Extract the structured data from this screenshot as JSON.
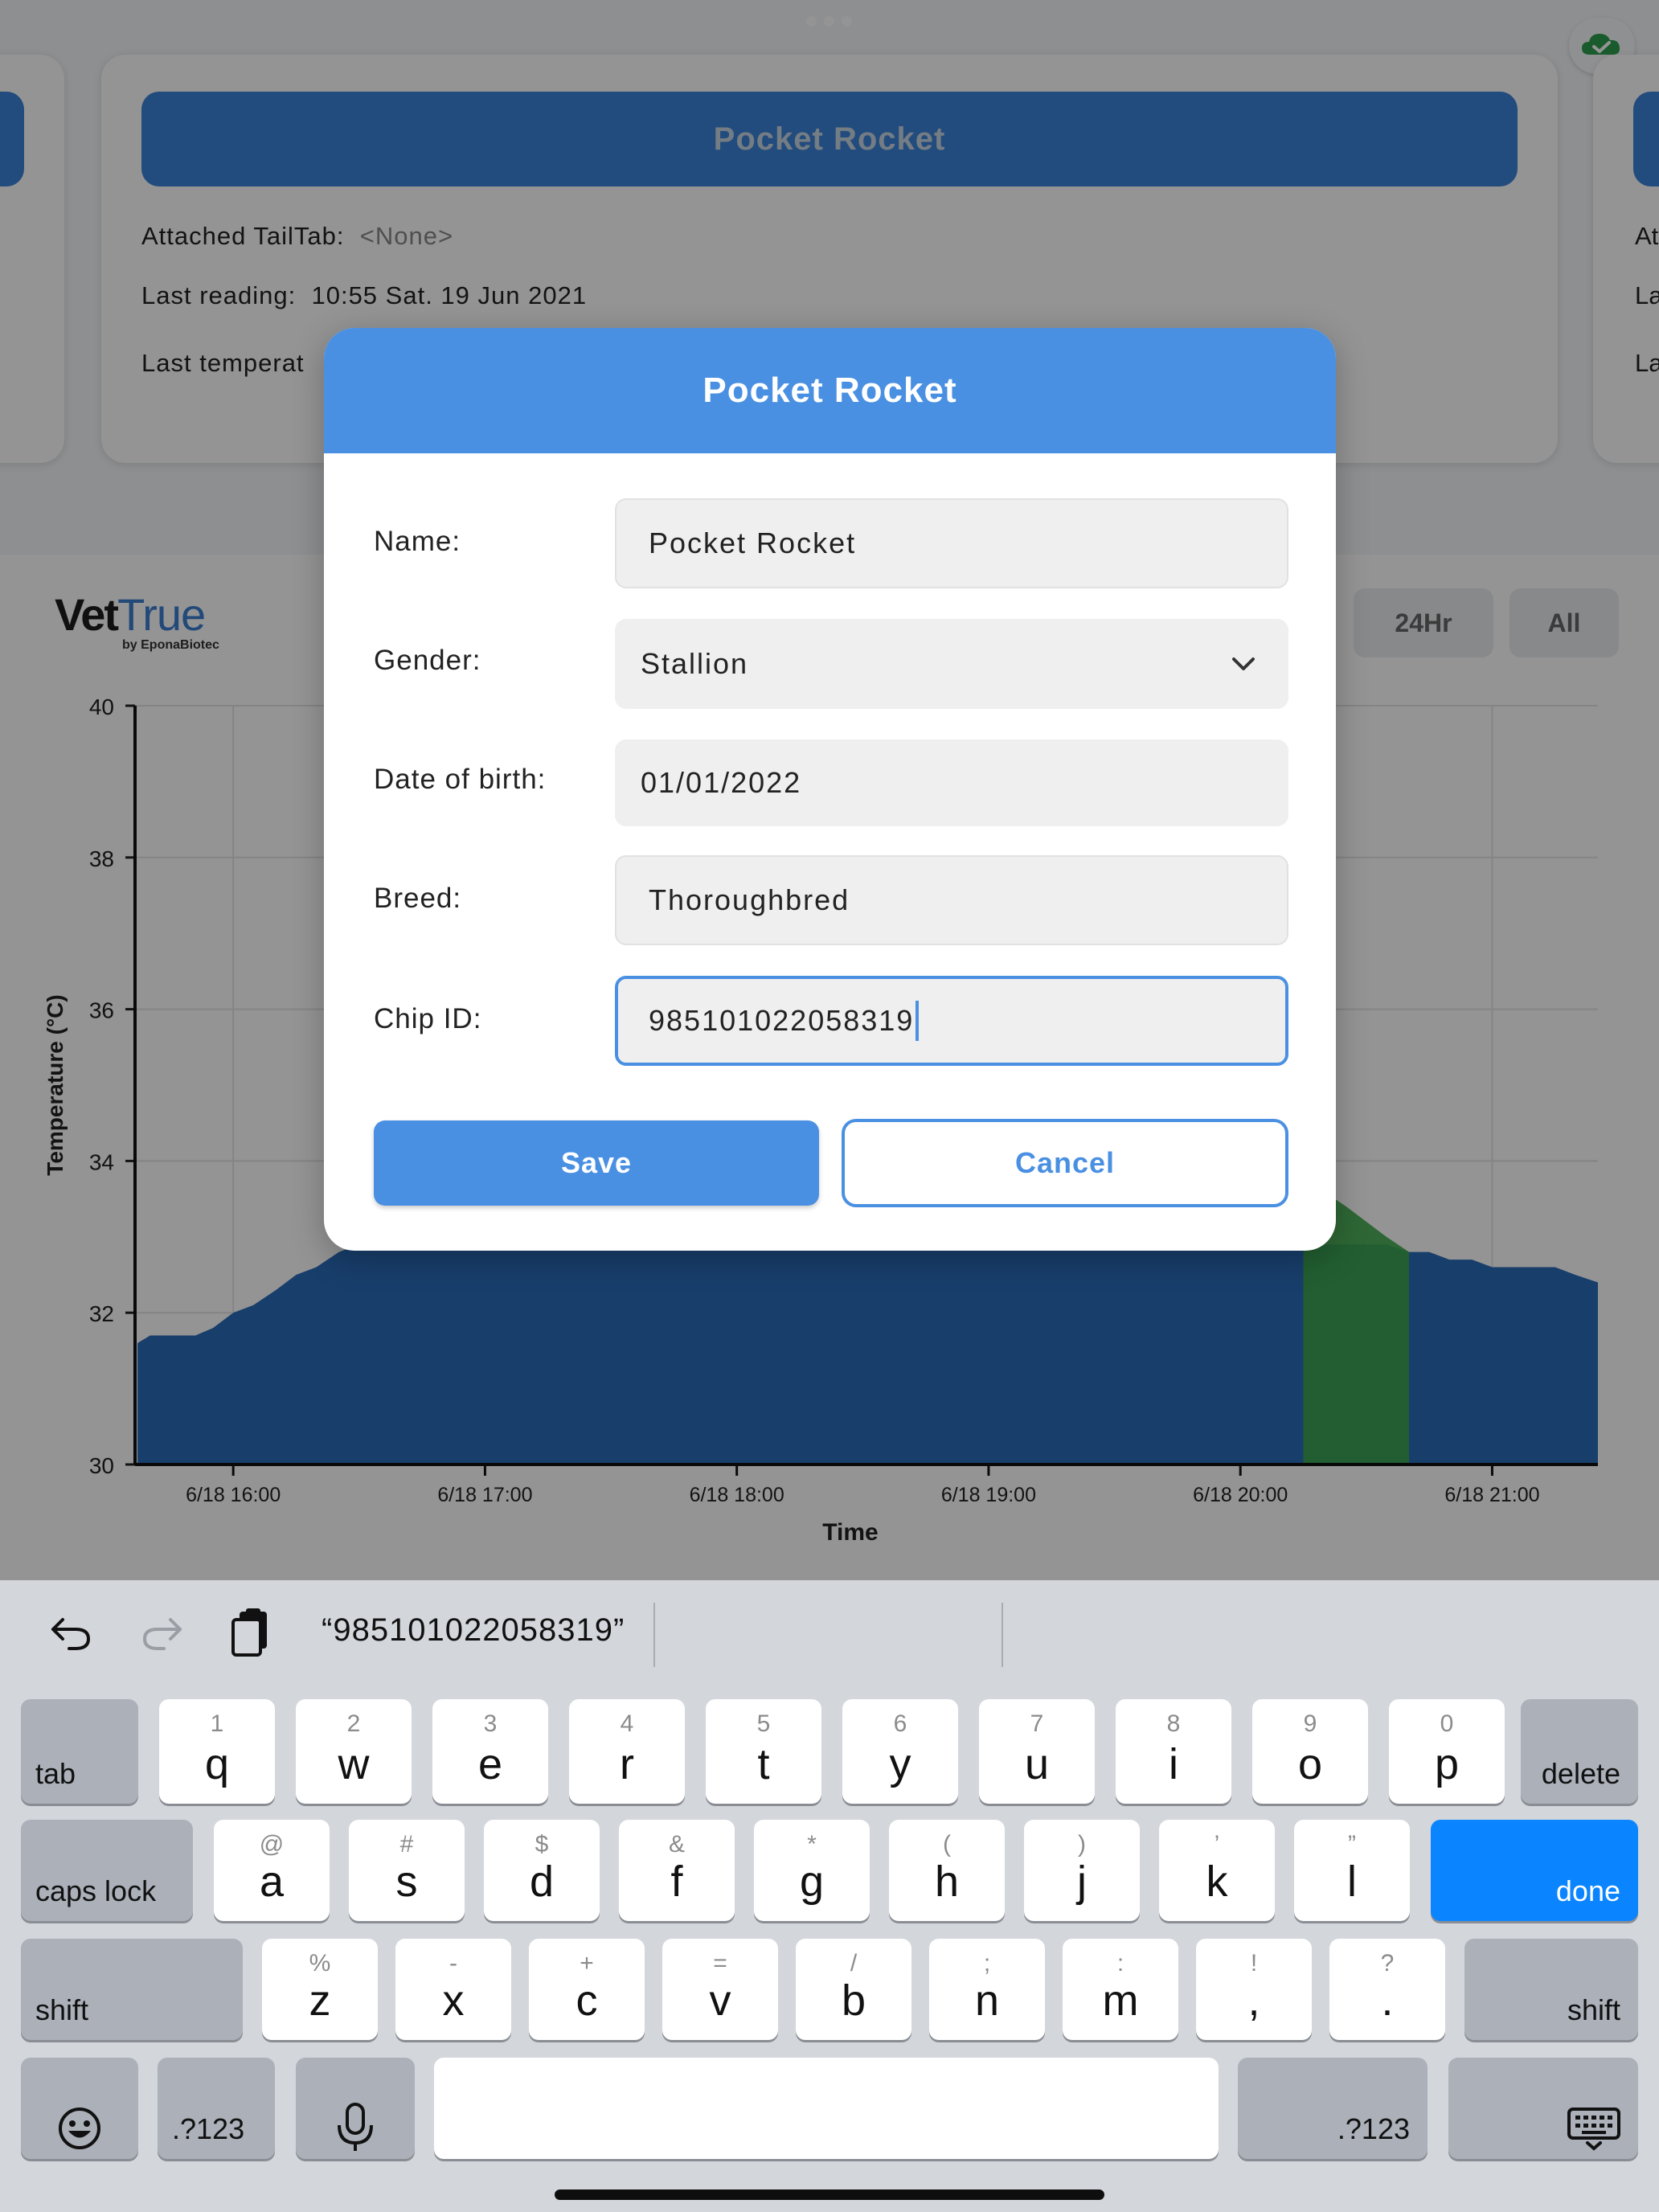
{
  "background": {
    "card_title": "Pocket Rocket",
    "attached_label": "Attached TailTab:",
    "attached_value": "<None>",
    "last_reading_label": "Last reading:",
    "last_reading_value": "10:55 Sat. 19 Jun 2021",
    "last_temp_label": "Last temperat",
    "side_card_lines": [
      "At",
      "La",
      "La"
    ],
    "logo_vet": "Vet",
    "logo_true": "True",
    "logo_by": "by EponaBiotec",
    "range_buttons": [
      "24Hr",
      "All"
    ],
    "cloud_icon_color": "#2e9e4f"
  },
  "chart_data": {
    "type": "area",
    "ylabel": "Temperature (°C)",
    "xlabel": "Time",
    "ylim": [
      30,
      40
    ],
    "yticks": [
      "30",
      "32",
      "34",
      "36",
      "38",
      "40"
    ],
    "xticks": [
      "6/18 16:00",
      "6/18 17:00",
      "6/18 18:00",
      "6/18 19:00",
      "6/18 20:00",
      "6/18 21:00"
    ],
    "grid": true,
    "series": [
      {
        "color": "#2a6bb8",
        "x_hours": [
          15.62,
          15.67,
          15.85,
          15.92,
          16.0,
          16.08,
          16.17,
          16.25,
          16.33,
          16.42,
          16.5,
          20.33,
          20.42,
          20.5,
          20.58,
          20.67,
          20.75,
          20.83,
          20.92,
          21.0,
          21.08,
          21.17,
          21.25,
          21.33,
          21.42
        ],
        "values": [
          31.6,
          31.7,
          31.7,
          31.8,
          32.0,
          32.1,
          32.3,
          32.5,
          32.6,
          32.8,
          32.9,
          32.9,
          32.9,
          32.9,
          32.9,
          32.8,
          32.8,
          32.7,
          32.7,
          32.6,
          32.6,
          32.6,
          32.6,
          32.5,
          32.4
        ]
      },
      {
        "color": "#3da84a",
        "x_hours": [
          20.25,
          20.33,
          20.42,
          20.5,
          20.58,
          20.67
        ],
        "values": [
          33.4,
          33.6,
          33.4,
          33.2,
          33.0,
          32.8
        ]
      }
    ]
  },
  "dialog": {
    "title": "Pocket Rocket",
    "fields": {
      "name_label": "Name:",
      "name_value": "Pocket Rocket",
      "gender_label": "Gender:",
      "gender_value": "Stallion",
      "dob_label": "Date of birth:",
      "dob_value": "01/01/2022",
      "breed_label": "Breed:",
      "breed_value": "Thoroughbred",
      "chip_label": "Chip ID:",
      "chip_value": "985101022058319"
    },
    "save_label": "Save",
    "cancel_label": "Cancel",
    "accent_color": "#4a90e2"
  },
  "keyboard": {
    "suggestion": "“985101022058319”",
    "row1": [
      {
        "main": "q",
        "alt": "1"
      },
      {
        "main": "w",
        "alt": "2"
      },
      {
        "main": "e",
        "alt": "3"
      },
      {
        "main": "r",
        "alt": "4"
      },
      {
        "main": "t",
        "alt": "5"
      },
      {
        "main": "y",
        "alt": "6"
      },
      {
        "main": "u",
        "alt": "7"
      },
      {
        "main": "i",
        "alt": "8"
      },
      {
        "main": "o",
        "alt": "9"
      },
      {
        "main": "p",
        "alt": "0"
      }
    ],
    "row2": [
      {
        "main": "a",
        "alt": "@"
      },
      {
        "main": "s",
        "alt": "#"
      },
      {
        "main": "d",
        "alt": "$"
      },
      {
        "main": "f",
        "alt": "&"
      },
      {
        "main": "g",
        "alt": "*"
      },
      {
        "main": "h",
        "alt": "("
      },
      {
        "main": "j",
        "alt": ")"
      },
      {
        "main": "k",
        "alt": "’"
      },
      {
        "main": "l",
        "alt": "”"
      }
    ],
    "row3": [
      {
        "main": "z",
        "alt": "%"
      },
      {
        "main": "x",
        "alt": "-"
      },
      {
        "main": "c",
        "alt": "+"
      },
      {
        "main": "v",
        "alt": "="
      },
      {
        "main": "b",
        "alt": "/"
      },
      {
        "main": "n",
        "alt": ";"
      },
      {
        "main": "m",
        "alt": ":"
      },
      {
        "main": ",",
        "alt": "!"
      },
      {
        "main": ".",
        "alt": "?"
      }
    ],
    "tab": "tab",
    "delete": "delete",
    "caps_lock": "caps lock",
    "done": "done",
    "shift": "shift",
    "numbers": ".?123",
    "done_color": "#0a84ff"
  }
}
